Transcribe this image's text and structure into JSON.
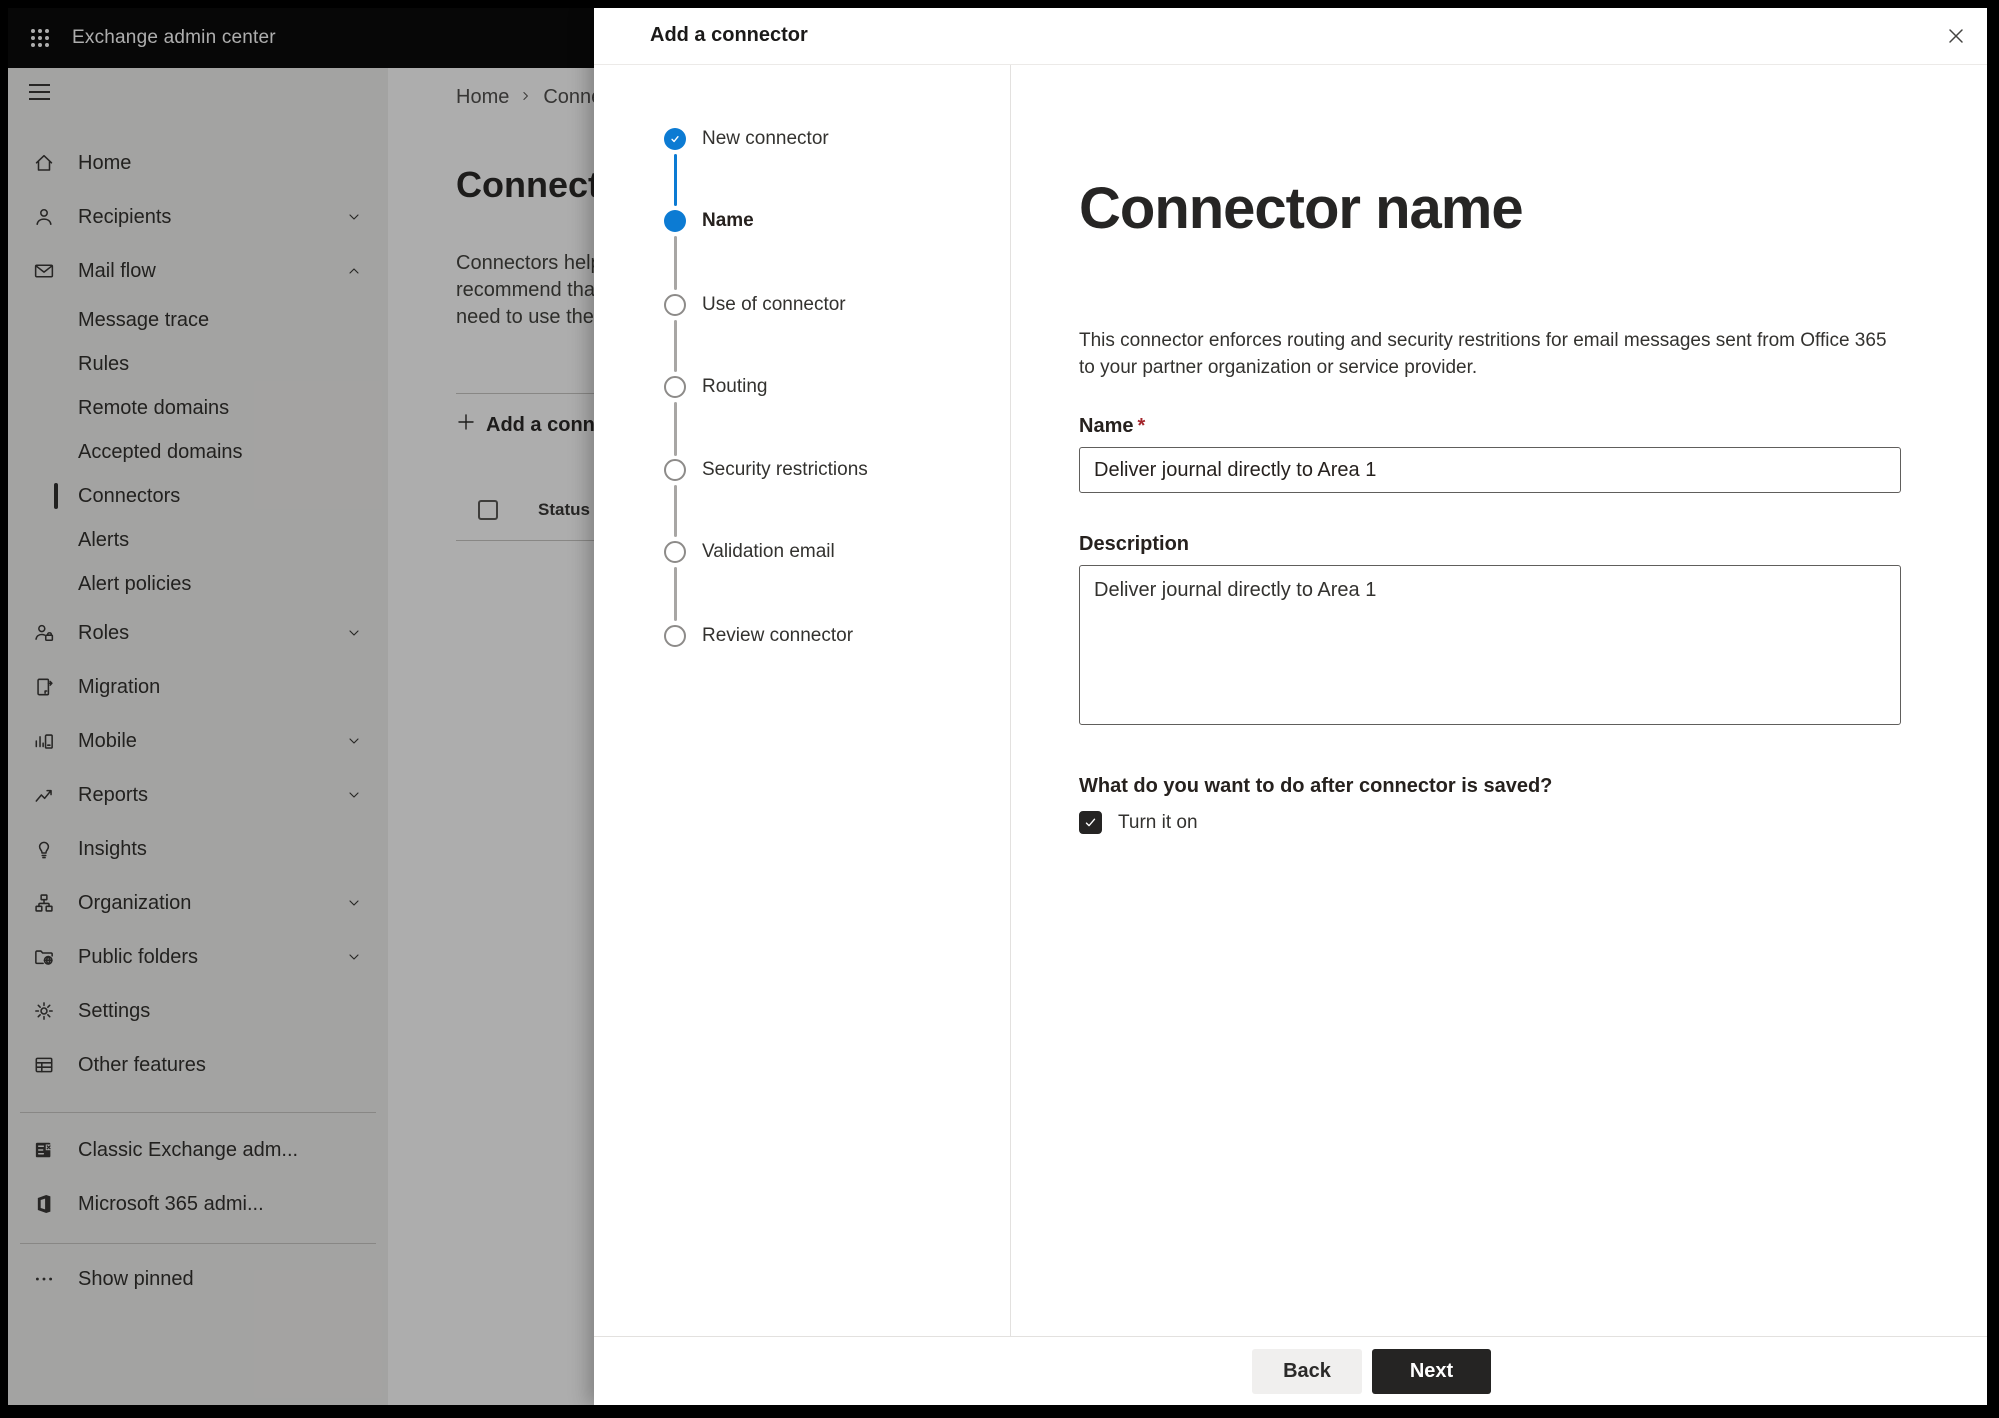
{
  "colors": {
    "accent_blue": "#0c7bd3",
    "primary_button_dark": "#252423",
    "required_red": "#a4262c",
    "overlay": "rgba(0,0,0,0.32)"
  },
  "topbar": {
    "title": "Exchange admin center"
  },
  "sidebar": {
    "items": [
      {
        "label": "Home"
      },
      {
        "label": "Recipients"
      },
      {
        "label": "Mail flow"
      },
      {
        "label": "Message trace"
      },
      {
        "label": "Rules"
      },
      {
        "label": "Remote domains"
      },
      {
        "label": "Accepted domains"
      },
      {
        "label": "Connectors",
        "selected": true
      },
      {
        "label": "Alerts"
      },
      {
        "label": "Alert policies"
      },
      {
        "label": "Roles"
      },
      {
        "label": "Migration"
      },
      {
        "label": "Mobile"
      },
      {
        "label": "Reports"
      },
      {
        "label": "Insights"
      },
      {
        "label": "Organization"
      },
      {
        "label": "Public folders"
      },
      {
        "label": "Settings"
      },
      {
        "label": "Other features"
      },
      {
        "label": "Classic Exchange adm..."
      },
      {
        "label": "Microsoft 365 admi..."
      },
      {
        "label": "Show pinned"
      }
    ]
  },
  "page": {
    "breadcrumb": {
      "home": "Home",
      "current": "Conne"
    },
    "heading": "Connect",
    "intro_lines": [
      "Connectors help",
      "recommend that",
      "need to use ther"
    ],
    "add_button": "Add a conn",
    "table": {
      "status_header": "Status"
    }
  },
  "dialog": {
    "title": "Add a connector",
    "steps": [
      {
        "label": "New connector",
        "state": "completed"
      },
      {
        "label": "Name",
        "state": "active"
      },
      {
        "label": "Use of connector",
        "state": "upcoming"
      },
      {
        "label": "Routing",
        "state": "upcoming"
      },
      {
        "label": "Security restrictions",
        "state": "upcoming"
      },
      {
        "label": "Validation email",
        "state": "upcoming"
      },
      {
        "label": "Review connector",
        "state": "upcoming"
      }
    ],
    "content": {
      "heading": "Connector name",
      "description_lines": [
        "This connector enforces routing and security restritions for email messages sent from Office 365",
        "to your partner organization or service provider."
      ],
      "name_label": "Name",
      "required_marker": "*",
      "name_value": "Deliver journal directly to Area 1",
      "description_label": "Description",
      "description_value": "Deliver journal directly to Area 1",
      "question": "What do you want to do after connector is saved?",
      "turn_on_label": "Turn it on",
      "turn_on_checked": true
    },
    "footer": {
      "back": "Back",
      "next": "Next"
    }
  }
}
